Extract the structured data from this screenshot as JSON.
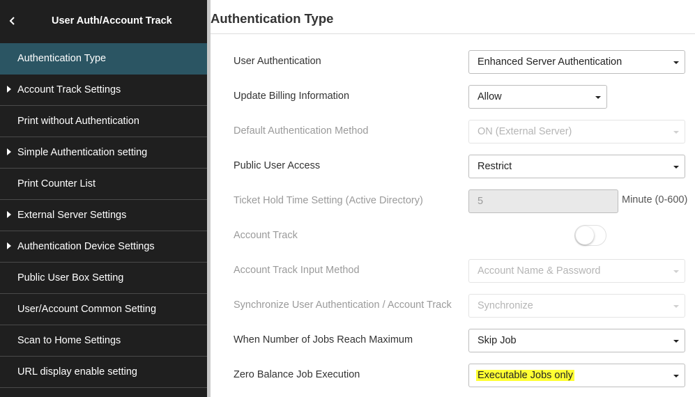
{
  "sidebar": {
    "title": "User Auth/Account Track",
    "items": [
      {
        "label": "Authentication Type",
        "active": true,
        "expandable": false
      },
      {
        "label": "Account Track Settings",
        "active": false,
        "expandable": true
      },
      {
        "label": "Print without Authentication",
        "active": false,
        "expandable": false
      },
      {
        "label": "Simple Authentication setting",
        "active": false,
        "expandable": true
      },
      {
        "label": "Print Counter List",
        "active": false,
        "expandable": false
      },
      {
        "label": "External Server Settings",
        "active": false,
        "expandable": true
      },
      {
        "label": "Authentication Device Settings",
        "active": false,
        "expandable": true
      },
      {
        "label": "Public User Box Setting",
        "active": false,
        "expandable": false
      },
      {
        "label": "User/Account Common Setting",
        "active": false,
        "expandable": false
      },
      {
        "label": "Scan to Home Settings",
        "active": false,
        "expandable": false
      },
      {
        "label": "URL display enable setting",
        "active": false,
        "expandable": false
      }
    ]
  },
  "main": {
    "title": "Authentication Type",
    "settings": [
      {
        "label": "User Authentication",
        "value": "Enhanced Server Authentication",
        "enabled": true
      },
      {
        "label": "Update Billing Information",
        "value": "Allow",
        "enabled": true
      },
      {
        "label": "Default Authentication Method",
        "value": "ON (External Server)",
        "enabled": false
      },
      {
        "label": "Public User Access",
        "value": "Restrict",
        "enabled": true
      },
      {
        "label": "Ticket Hold Time Setting (Active Directory)",
        "value": "5",
        "unit": "Minute (0-600)",
        "enabled": false
      },
      {
        "label": "Account Track",
        "toggle_on": false,
        "enabled": false
      },
      {
        "label": "Account Track Input Method",
        "value": "Account Name & Password",
        "enabled": false
      },
      {
        "label": "Synchronize User Authentication / Account Track",
        "value": "Synchronize",
        "enabled": false
      },
      {
        "label": "When Number of Jobs Reach Maximum",
        "value": "Skip Job",
        "enabled": true
      },
      {
        "label": "Zero Balance Job Execution",
        "value": "Executable Jobs only",
        "enabled": true,
        "highlighted": true
      }
    ]
  },
  "colors": {
    "sidebar_bg": "#1f1f1f",
    "sidebar_active": "#2b5563",
    "highlight": "#ffff33"
  }
}
